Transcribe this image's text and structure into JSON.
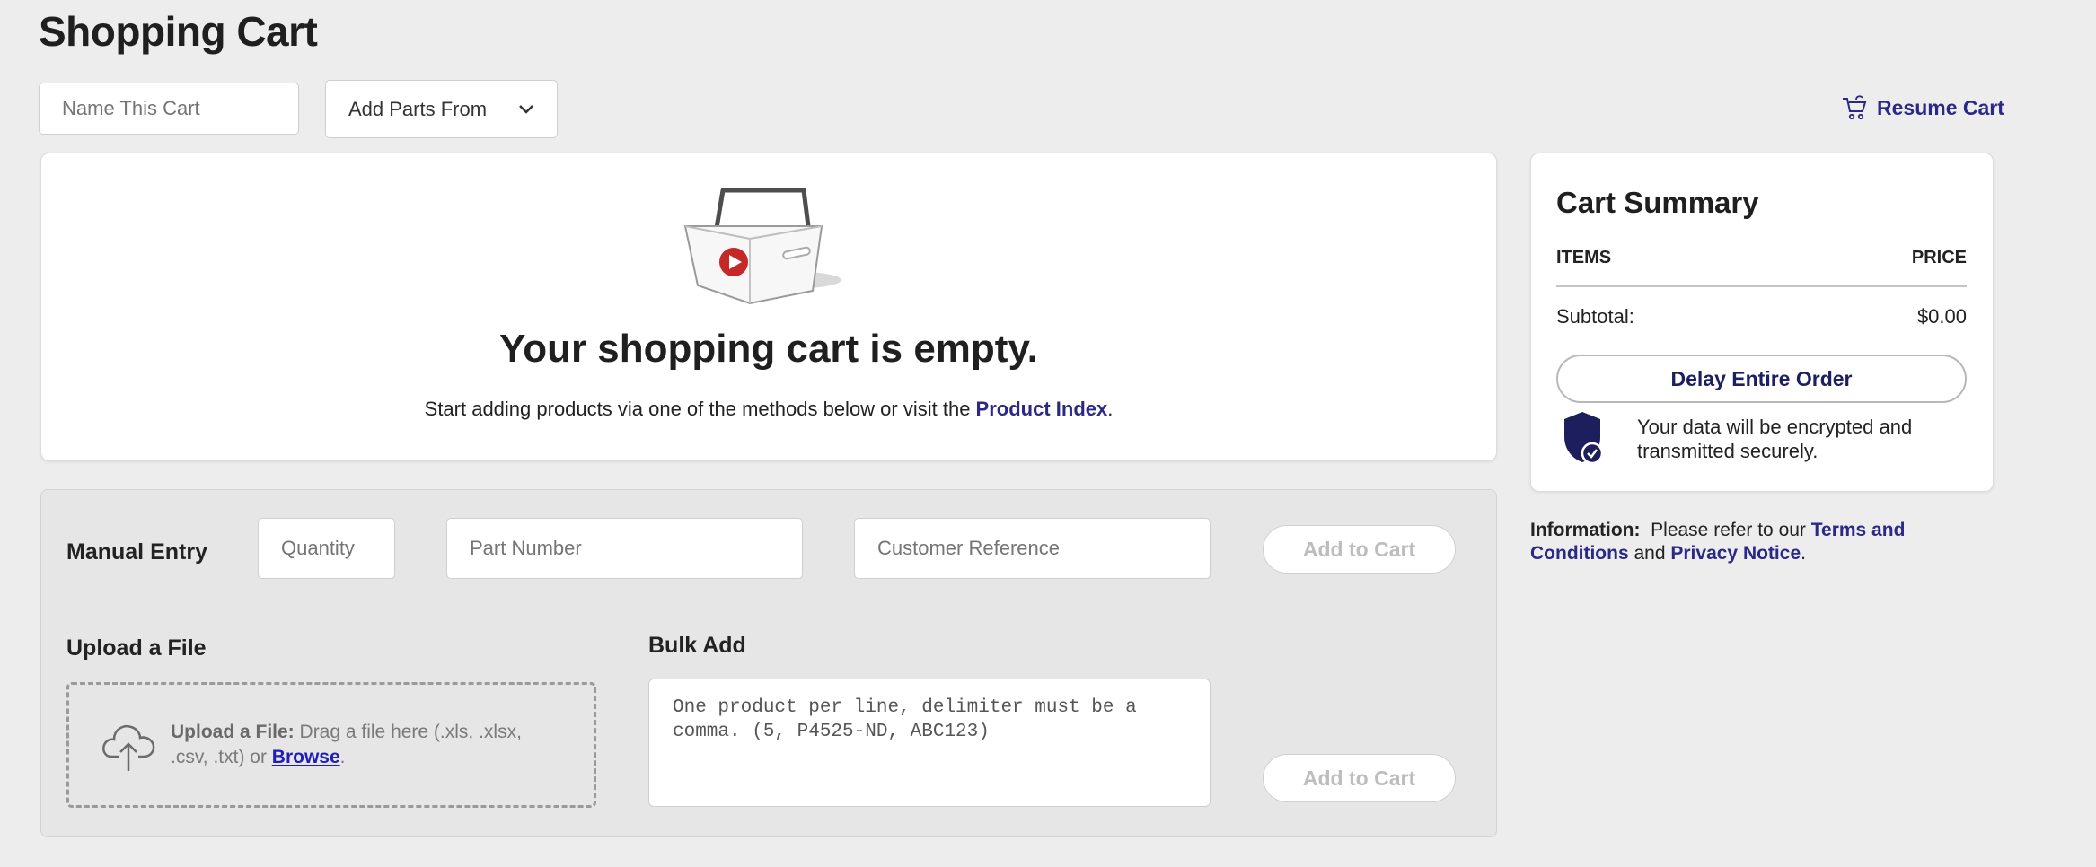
{
  "page": {
    "title": "Shopping Cart"
  },
  "toolbar": {
    "cart_name_placeholder": "Name This Cart",
    "add_parts_label": "Add Parts From",
    "resume_cart_label": "Resume Cart"
  },
  "empty_state": {
    "title": "Your shopping cart is empty.",
    "subtitle_prefix": "Start adding products via one of the methods below or visit the ",
    "product_index_link": "Product Index",
    "subtitle_suffix": "."
  },
  "manual_entry": {
    "label": "Manual Entry",
    "quantity_placeholder": "Quantity",
    "part_number_placeholder": "Part Number",
    "customer_reference_placeholder": "Customer Reference",
    "add_button": "Add to Cart"
  },
  "upload": {
    "label": "Upload a File",
    "prefix": "Upload a File:",
    "text": " Drag a file here (.xls, .xlsx, .csv, .txt) or ",
    "browse": "Browse",
    "suffix": "."
  },
  "bulk_add": {
    "label": "Bulk Add",
    "placeholder": "One product per line, delimiter must be a comma. (5, P4525-ND, ABC123)",
    "add_button": "Add to Cart"
  },
  "summary": {
    "title": "Cart Summary",
    "items_header": "ITEMS",
    "price_header": "PRICE",
    "subtotal_label": "Subtotal:",
    "subtotal_value": "$0.00",
    "delay_button": "Delay Entire Order",
    "secure_text": "Your data will be encrypted and transmitted securely."
  },
  "info": {
    "label": "Information:",
    "text": "Please refer to our ",
    "terms_link": "Terms and Conditions",
    "and": " and ",
    "privacy_link": "Privacy Notice",
    "suffix": "."
  },
  "colors": {
    "brand_link": "#2b2886",
    "background": "#ededed",
    "shield": "#1d1f5c",
    "logo_red": "#c62828"
  },
  "icons": [
    "cart-icon",
    "chevron-down-icon",
    "basket-illustration",
    "cloud-upload-icon",
    "shield-check-icon"
  ]
}
